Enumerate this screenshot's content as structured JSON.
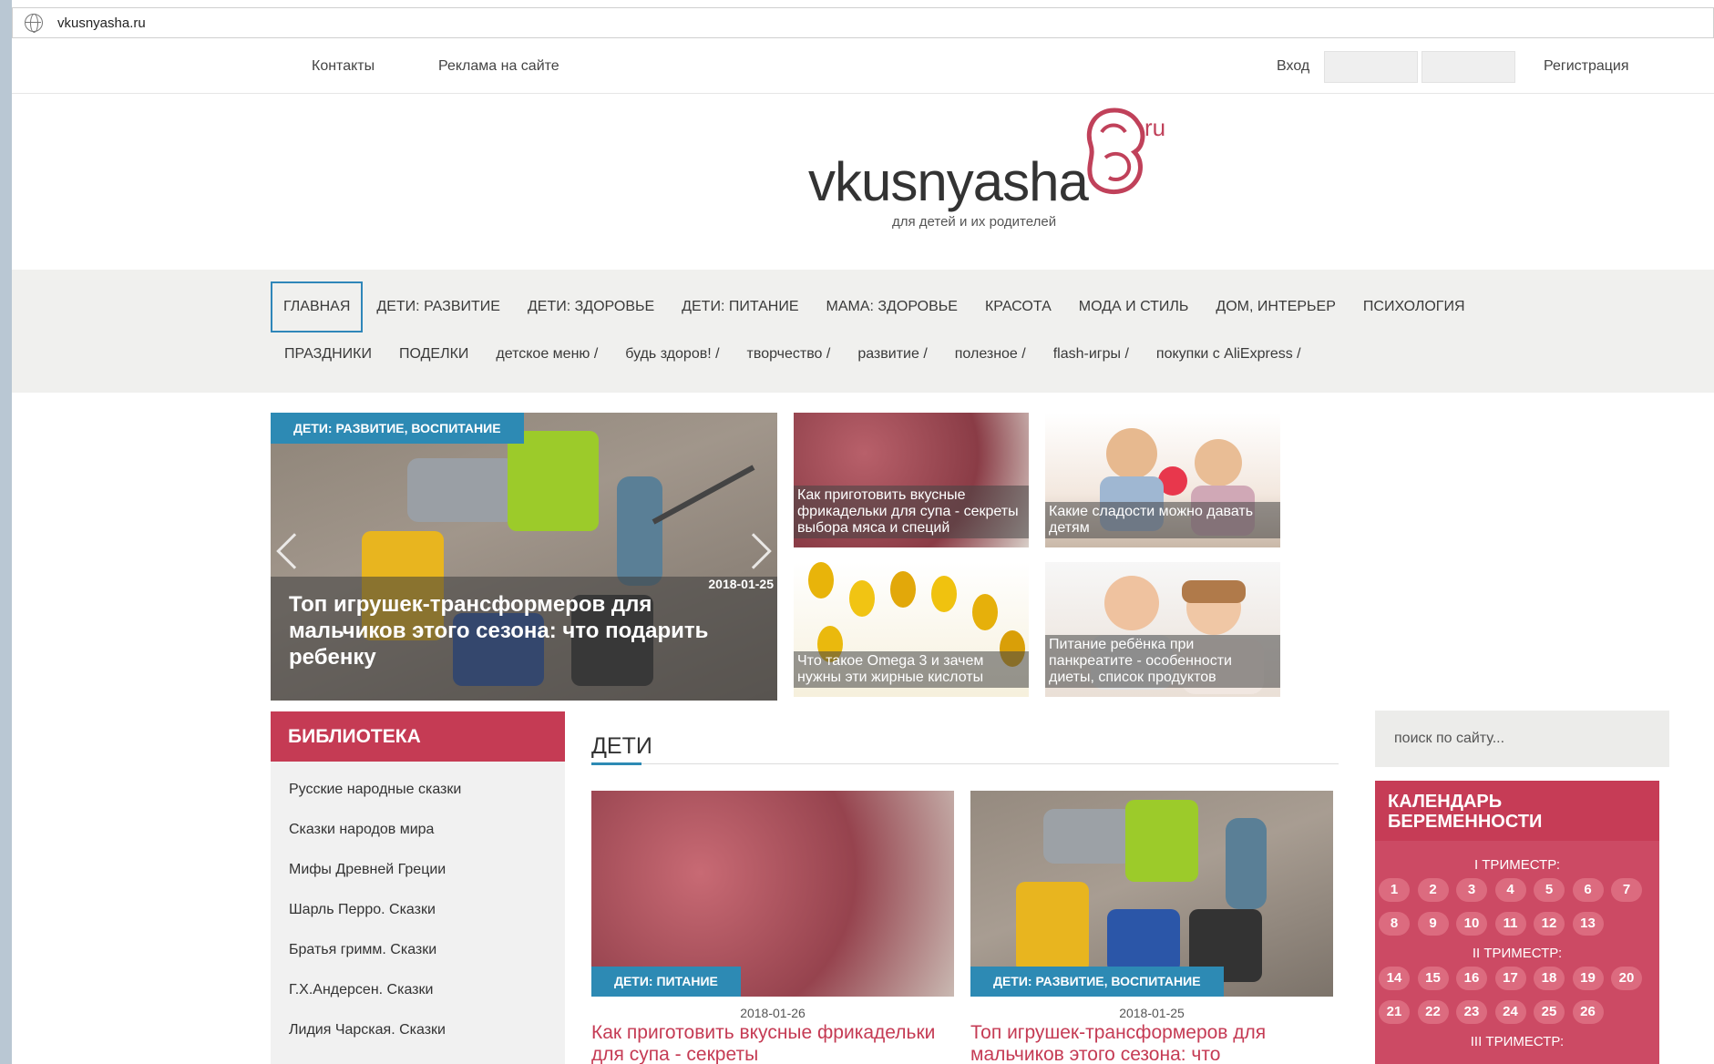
{
  "browser": {
    "url": "vkusnyasha.ru"
  },
  "topbar": {
    "contacts": "Контакты",
    "ads": "Реклама на сайте",
    "login": "Вход",
    "register": "Регистрация"
  },
  "logo": {
    "name": "vkusnyasha",
    "tld": "ru",
    "tagline": "для детей и их родителей"
  },
  "nav": {
    "row1": [
      "ГЛАВНАЯ",
      "ДЕТИ: РАЗВИТИЕ",
      "ДЕТИ: ЗДОРОВЬЕ",
      "ДЕТИ: ПИТАНИЕ",
      "МАМА: ЗДОРОВЬЕ",
      "КРАСОТА",
      "МОДА И СТИЛЬ",
      "ДОМ, ИНТЕРЬЕР",
      "ПСИХОЛОГИЯ"
    ],
    "row2": [
      "ПРАЗДНИКИ",
      "ПОДЕЛКИ",
      "детское меню /",
      "будь здоров! /",
      "творчество /",
      "развитие /",
      "полезное /",
      "flash-игры /",
      "покупки с AliExpress /"
    ]
  },
  "hero": {
    "category": "ДЕТИ: РАЗВИТИЕ, ВОСПИТАНИЕ",
    "date": "2018-01-25",
    "title": "Топ игрушек-трансформеров для мальчиков этого сезона: что подарить ребенку"
  },
  "thumbs": [
    {
      "caption": "Как приготовить вкусные фрикадельки для супа - секреты выбора мяса и специй"
    },
    {
      "caption": "Какие сладости можно давать детям"
    },
    {
      "caption": "Что такое Omega 3 и зачем нужны эти жирные кислоты"
    },
    {
      "caption": "Питание ребёнка при панкреатите - особенности диеты, список продуктов"
    }
  ],
  "library": {
    "title": "БИБЛИОТЕКА",
    "items": [
      "Русские народные сказки",
      "Сказки народов мира",
      "Мифы Древней Греции",
      "Шарль Перро. Сказки",
      "Братья гримм. Сказки",
      "Г.Х.Андерсен. Сказки",
      "Лидия Чарская. Сказки"
    ]
  },
  "section": {
    "title": "ДЕТИ",
    "cards": [
      {
        "category": "ДЕТИ: ПИТАНИЕ",
        "date": "2018-01-26",
        "title": "Как приготовить вкусные фрикадельки для супа - секреты"
      },
      {
        "category": "ДЕТИ: РАЗВИТИЕ, ВОСПИТАНИЕ",
        "date": "2018-01-25",
        "title": "Топ игрушек-трансформеров для мальчиков этого сезона: что"
      }
    ]
  },
  "search": {
    "placeholder": "поиск по сайту..."
  },
  "calendar": {
    "title_line1": "КАЛЕНДАРЬ",
    "title_line2": "БЕРЕМЕННОСТИ",
    "tri1": "I ТРИМЕСТР:",
    "tri2": "II ТРИМЕСТР:",
    "tri3": "III ТРИМЕСТР:",
    "weeks1": [
      "1",
      "2",
      "3",
      "4",
      "5",
      "6",
      "7",
      "8",
      "9",
      "10",
      "11",
      "12",
      "13"
    ],
    "weeks2": [
      "14",
      "15",
      "16",
      "17",
      "18",
      "19",
      "20",
      "21",
      "22",
      "23",
      "24",
      "25",
      "26"
    ]
  },
  "colors": {
    "accent": "#c53b54",
    "blue": "#2d8ab4",
    "nav_bg": "#f0f0ee"
  }
}
